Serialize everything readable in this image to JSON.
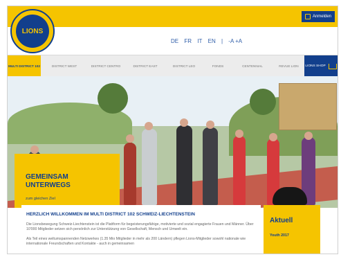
{
  "top": {
    "login_label": "Anmelden"
  },
  "logo": {
    "text": "LIONS",
    "subtext": "INTERNATIONAL",
    "icon": "lions-emblem-icon"
  },
  "languages": {
    "items": [
      "DE",
      "FR",
      "IT",
      "EN"
    ],
    "separator": "|",
    "font_controls": "-A +A"
  },
  "nav": {
    "items": [
      {
        "label": "MULTI DISTRICT 102",
        "active": true
      },
      {
        "label": "DISTRICT WEST",
        "active": false
      },
      {
        "label": "DISTRICT CENTRO",
        "active": false
      },
      {
        "label": "DISTRICT EAST",
        "active": false
      },
      {
        "label": "DISTRICT LEO",
        "active": false
      },
      {
        "label": "FONDS",
        "active": false
      },
      {
        "label": "CENTENNIAL",
        "active": false
      },
      {
        "label": "REVUE LION",
        "active": false
      }
    ],
    "shop_label": "LIONS SHOP",
    "shop_icon": "cart-icon"
  },
  "hero": {
    "title_line1": "GEMEINSAM",
    "title_line2": "UNTERWEGS",
    "subtitle": "zum gleichen Ziel"
  },
  "welcome": {
    "title": "HERZLICH WILLKOMMEN IM MULTI DISTRICT 102 SCHWEIZ-LIECHTENSTEIN",
    "paragraph1": "Die Lionsbewegung Schweiz-Liechtenstein ist die Plattform für begeisterungsfähige, motivierte und sozial engagierte Frauen und Männer. Über 10'000 Mitglieder setzen sich persönlich zur Unterstützung von Gesellschaft, Mensch und Umwelt ein.",
    "paragraph2": "Als Teil eines weltumspannenden Netzwerkes (1.35 Mio Mitglieder in mehr als 200 Ländern) pflegen Lions-Mitglieder sowohl nationale wie internationale Freundschaften und Kontakte - auch in gemeinsamen"
  },
  "aktuell": {
    "title": "Aktuell",
    "items": [
      "Youth 2017"
    ]
  },
  "colors": {
    "brand_yellow": "#f5c400",
    "brand_blue": "#123f8c",
    "nav_gray": "#ececec"
  }
}
